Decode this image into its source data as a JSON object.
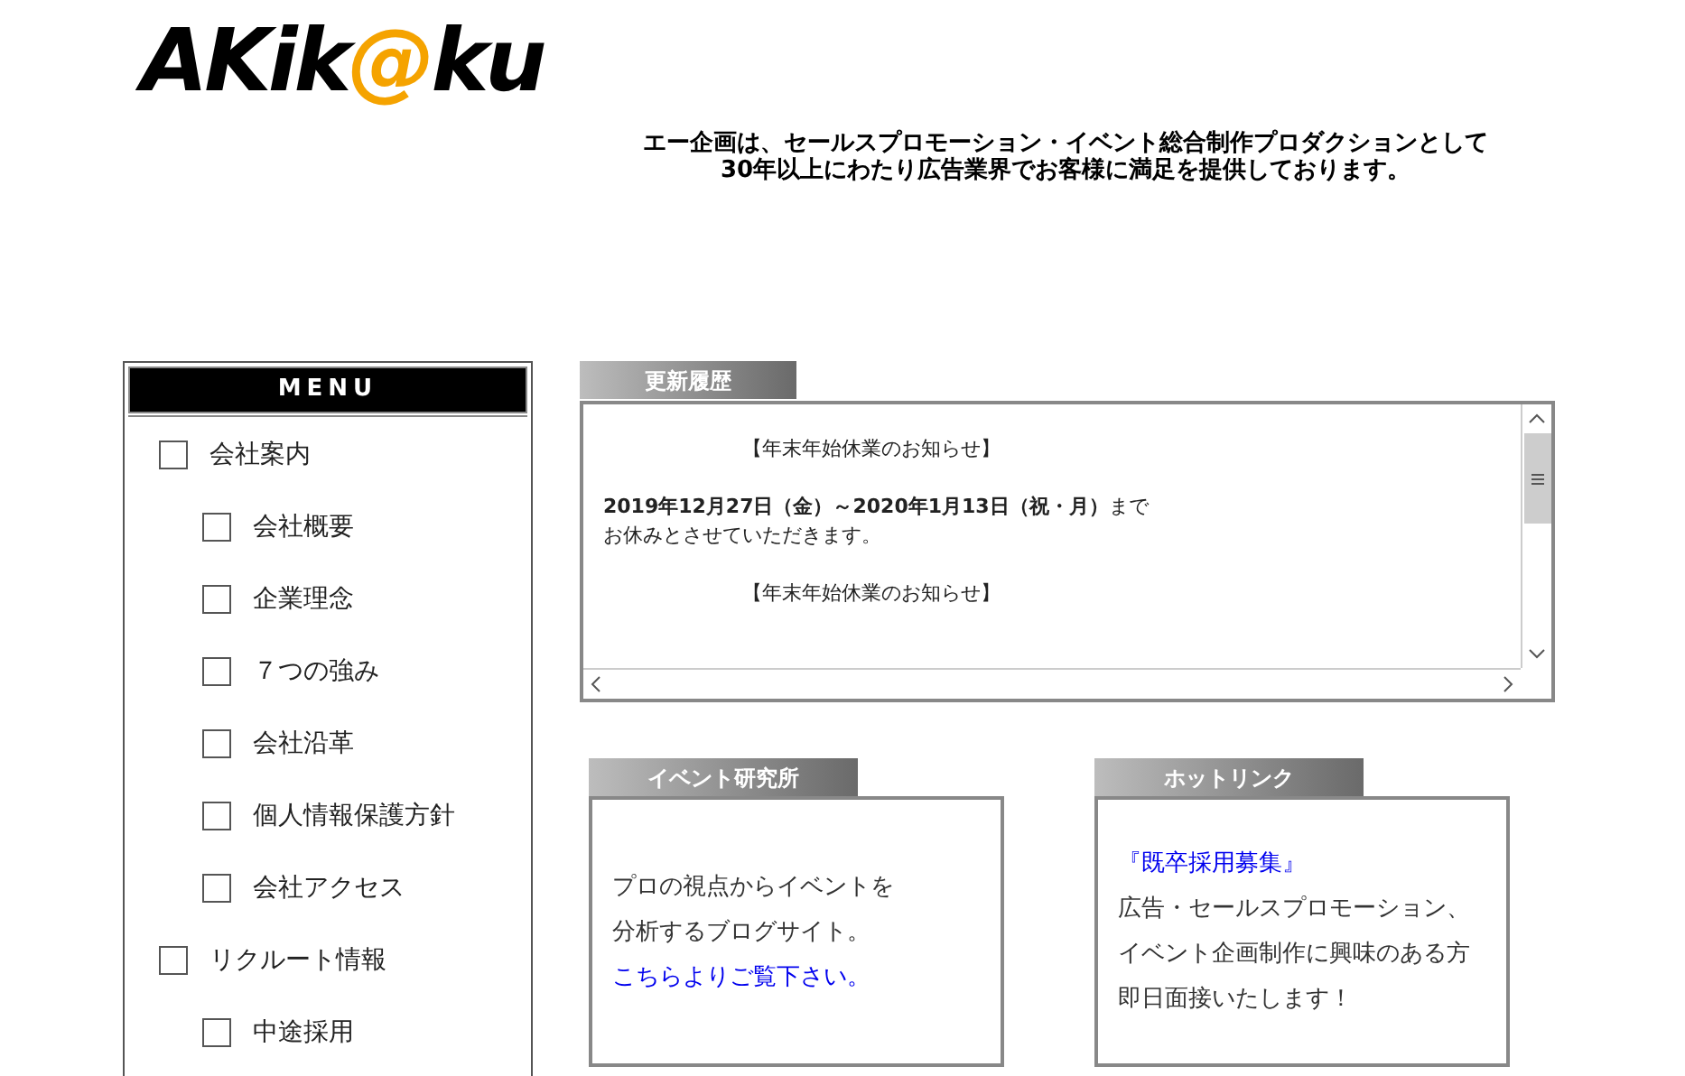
{
  "logo": {
    "parts": [
      {
        "text": "AKik",
        "color": "#000000"
      },
      {
        "text": "@",
        "color": "#f5a300"
      },
      {
        "text": "ku",
        "color": "#000000"
      }
    ]
  },
  "tagline": [
    "エー企画は、セールスプロモーション・イベント総合制作プロダクションとして",
    "30年以上にわたり広告業界でお客様に満足を提供しております。"
  ],
  "menu": {
    "title": "MENU",
    "items": [
      {
        "label": "会社案内",
        "children": [
          {
            "label": "会社概要"
          },
          {
            "label": "企業理念"
          },
          {
            "label": "７つの強み"
          },
          {
            "label": "会社沿革"
          },
          {
            "label": "個人情報保護方針"
          },
          {
            "label": "会社アクセス"
          }
        ]
      },
      {
        "label": "リクルート情報",
        "children": [
          {
            "label": "中途採用"
          }
        ]
      }
    ]
  },
  "news": {
    "title": "更新履歴",
    "lines": [
      {
        "kind": "heading",
        "text": "【年末年始休業のお知らせ】"
      },
      {
        "kind": "gap"
      },
      {
        "kind": "text",
        "text": "**2019年12月27日（金）～2020年1月13日（祝・月）**まで"
      },
      {
        "kind": "text",
        "text": "お休みとさせていただきます。"
      },
      {
        "kind": "gap"
      },
      {
        "kind": "heading",
        "text": "【年末年始休業のお知らせ】"
      }
    ]
  },
  "panels": [
    {
      "title": "イベント研究所",
      "lines": [
        {
          "kind": "text",
          "text": "プロの視点からイベントを"
        },
        {
          "kind": "text",
          "text": "分析するブログサイト。"
        },
        {
          "kind": "link",
          "text": "こちらよりご覧下さい。"
        }
      ]
    },
    {
      "title": "ホットリンク",
      "lines": [
        {
          "kind": "link",
          "text": "『既卒採用募集』"
        },
        {
          "kind": "text",
          "text": "広告・セールスプロモーション、"
        },
        {
          "kind": "text",
          "text": "イベント企画制作に興味のある方"
        },
        {
          "kind": "text",
          "text": "即日面接いたします！"
        }
      ]
    }
  ]
}
